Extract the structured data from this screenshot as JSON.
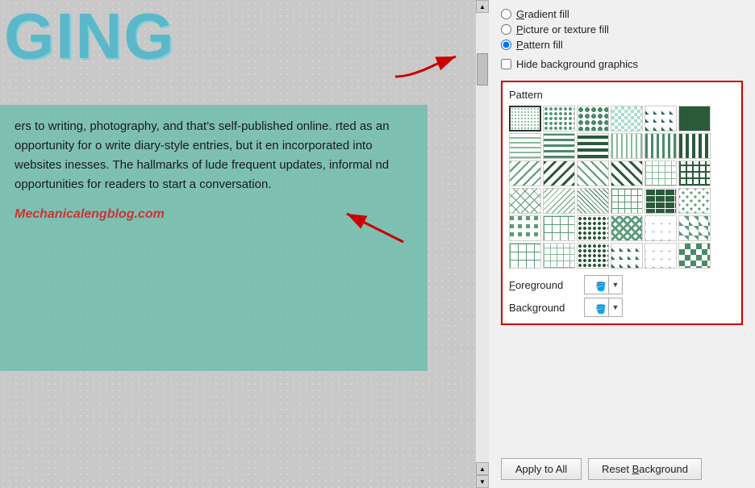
{
  "slide": {
    "title": "GING",
    "content": "ers to writing, photography, and that's self-published online. rted as an opportunity for o write diary-style entries, but it en incorporated into websites inesses. The hallmarks of lude frequent updates, informal nd opportunities for readers to start a conversation.",
    "watermark": "Mechanicalengblog.com"
  },
  "panel": {
    "gradient_fill_label": "Gradient fill",
    "picture_texture_label": "Picture or texture fill",
    "pattern_fill_label": "Pattern fill",
    "hide_bg_label": "Hide background graphics",
    "pattern_section_title": "Pattern",
    "foreground_label": "Foreground",
    "background_label": "Background",
    "apply_all_label": "Apply to All",
    "reset_bg_label": "Reset Background"
  },
  "radio": {
    "gradient_fill": {
      "label": "Gradient fill",
      "checked": false
    },
    "picture_texture": {
      "label": "Picture or texture fill",
      "checked": false
    },
    "pattern_fill": {
      "label": "Pattern fill",
      "checked": true
    }
  }
}
